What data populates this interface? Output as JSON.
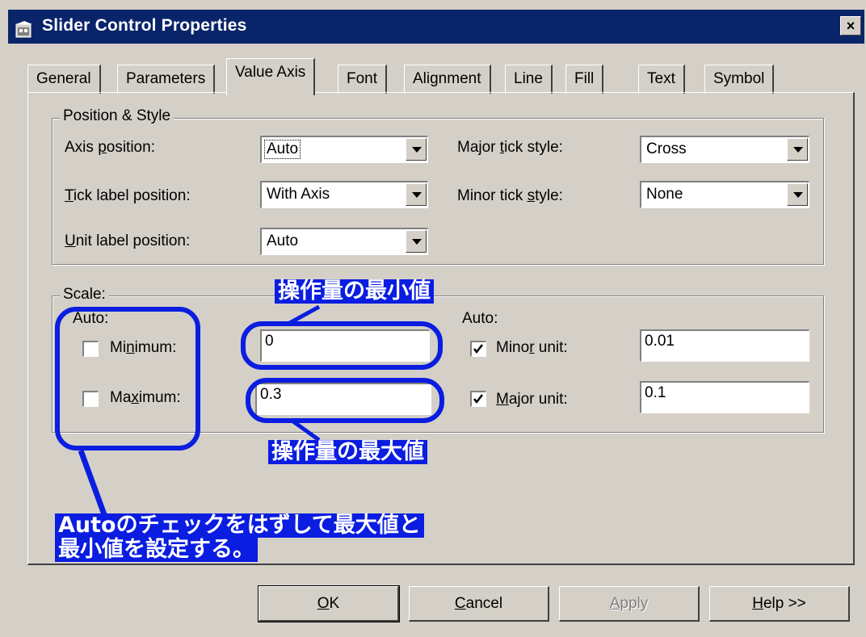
{
  "window": {
    "title": "Slider Control Properties",
    "close_glyph": "×"
  },
  "tabs": [
    {
      "label": "General"
    },
    {
      "label": "Parameters"
    },
    {
      "label": "Value Axis",
      "active": true
    },
    {
      "label": "Font"
    },
    {
      "label": "Alignment"
    },
    {
      "label": "Line"
    },
    {
      "label": "Fill"
    },
    {
      "label": "Text"
    },
    {
      "label": "Symbol"
    }
  ],
  "position_style": {
    "legend": "Position & Style",
    "axis_position": {
      "label_pre": "Axis ",
      "label_key": "p",
      "label_post": "osition:",
      "value": "Auto"
    },
    "tick_label_position": {
      "label_pre": "",
      "label_key": "T",
      "label_post": "ick label position:",
      "value": "With Axis"
    },
    "unit_label_position": {
      "label_pre": "",
      "label_key": "U",
      "label_post": "nit label position:",
      "value": "Auto"
    },
    "major_tick_style": {
      "label_pre": "Major ",
      "label_key": "t",
      "label_post": "ick style:",
      "value": "Cross"
    },
    "minor_tick_style": {
      "label_pre": "Minor tick ",
      "label_key": "s",
      "label_post": "tyle:",
      "value": "None"
    }
  },
  "scale": {
    "legend": "Scale:",
    "auto_left": "Auto:",
    "auto_right": "Auto:",
    "minimum": {
      "label_pre": "Mi",
      "label_key": "n",
      "label_post": "imum:",
      "checked": false,
      "value": "0"
    },
    "maximum": {
      "label_pre": "Ma",
      "label_key": "x",
      "label_post": "imum:",
      "checked": false,
      "value": "0.3"
    },
    "minor_unit": {
      "label_pre": "Mino",
      "label_key": "r",
      "label_post": " unit:",
      "checked": true,
      "value": "0.01"
    },
    "major_unit": {
      "label_pre": "",
      "label_key": "M",
      "label_post": "ajor unit:",
      "checked": true,
      "value": "0.1"
    }
  },
  "annotations": {
    "min_value": "操作量の最小値",
    "max_value": "操作量の最大値",
    "instruction_line1": "Autoのチェックをはずして最大値と",
    "instruction_line2": "最小値を設定する。",
    "color": "#0a1de0"
  },
  "buttons": {
    "ok": {
      "key": "O",
      "rest": "K"
    },
    "cancel": {
      "key": "C",
      "rest": "ancel"
    },
    "apply": {
      "key": "A",
      "rest": "pply"
    },
    "help": {
      "key": "H",
      "rest": "elp >>"
    }
  },
  "colors": {
    "face": "#d4d0c8",
    "titlebar": "#0a246a",
    "annotation": "#0a1de0"
  }
}
